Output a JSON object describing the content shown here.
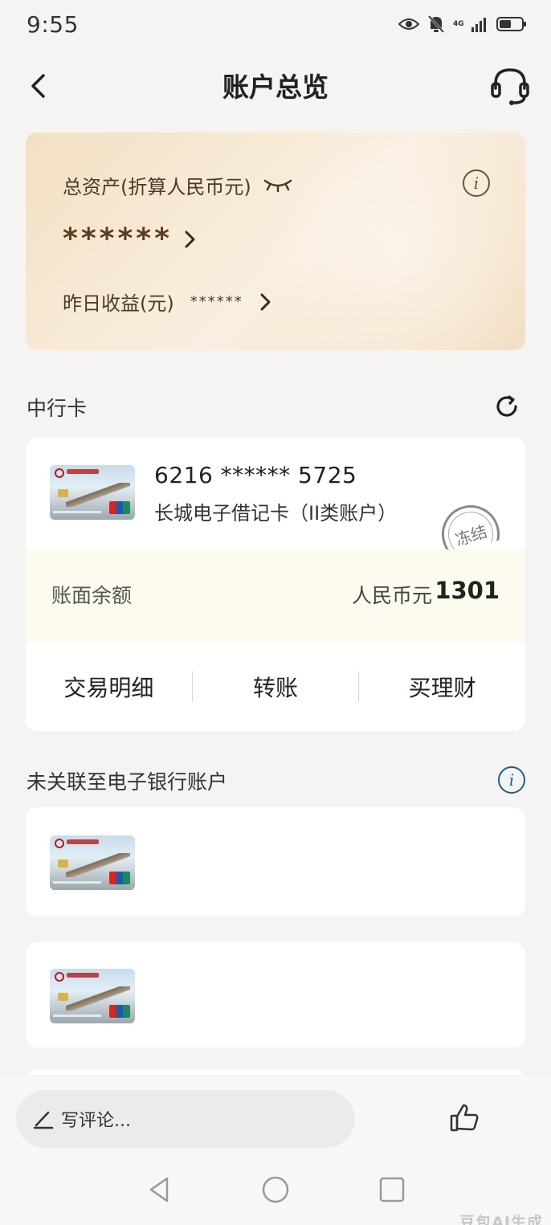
{
  "status_bar": {
    "time": "9:55",
    "network": "4G",
    "icons": [
      "eye-icon",
      "bell-muted-icon",
      "signal-icon",
      "battery-icon"
    ]
  },
  "header": {
    "title": "账户总览"
  },
  "assets": {
    "total_label": "总资产(折算人民币元)",
    "total_value": "******",
    "yesterday_label": "昨日收益(元)",
    "yesterday_value": "******"
  },
  "boc_section": {
    "title": "中行卡",
    "card": {
      "number": "6216 ****** 5725",
      "type": "长城电子借记卡（II类账户）",
      "status_stamp": "冻结",
      "balance_label": "账面余额",
      "currency": "人民币元",
      "balance": "1301",
      "actions": [
        "交易明细",
        "转账",
        "买理财"
      ]
    }
  },
  "unlinked_section": {
    "title": "未关联至电子银行账户"
  },
  "bottom_bar": {
    "comment_placeholder": "写评论..."
  },
  "watermark": "豆包AI生成",
  "colors": {
    "asset_card": "#f3e0c3",
    "asset_text": "#4a3a28",
    "info_blue": "#1f5f8c"
  }
}
